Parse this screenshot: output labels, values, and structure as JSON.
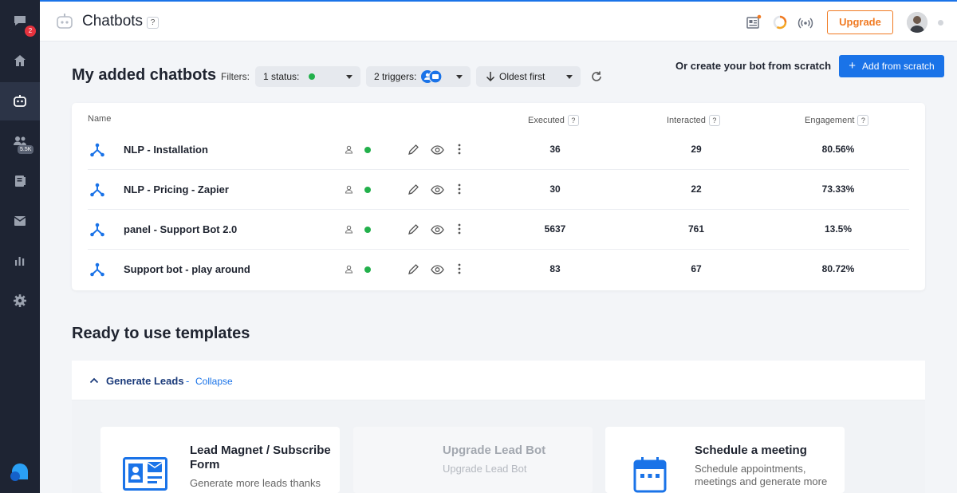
{
  "sidebar": {
    "items": [
      {
        "name": "chat-icon",
        "badge": "2"
      },
      {
        "name": "home-icon"
      },
      {
        "name": "bot-icon"
      },
      {
        "name": "contacts-icon",
        "badge": "5.5K"
      },
      {
        "name": "knowledge-icon"
      },
      {
        "name": "inbox-icon"
      },
      {
        "name": "analytics-icon"
      },
      {
        "name": "settings-icon"
      }
    ]
  },
  "header": {
    "title": "Chatbots",
    "help": "?",
    "upgrade_label": "Upgrade"
  },
  "bots_section": {
    "title": "My added chatbots",
    "filters_label": "Filters:",
    "status_filter": "1 status:",
    "triggers_filter": "2 triggers:",
    "sort_filter": "Oldest first",
    "create_label": "Or create your bot from scratch",
    "add_button": "Add from scratch"
  },
  "table": {
    "columns": {
      "name": "Name",
      "executed": "Executed",
      "interacted": "Interacted",
      "engagement": "Engagement"
    },
    "help": "?",
    "rows": [
      {
        "name": "NLP - Installation",
        "executed": "36",
        "interacted": "29",
        "engagement": "80.56%"
      },
      {
        "name": "NLP - Pricing - Zapier",
        "executed": "30",
        "interacted": "22",
        "engagement": "73.33%"
      },
      {
        "name": "panel - Support Bot 2.0",
        "executed": "5637",
        "interacted": "761",
        "engagement": "13.5%"
      },
      {
        "name": "Support bot - play around",
        "executed": "83",
        "interacted": "67",
        "engagement": "80.72%"
      }
    ]
  },
  "templates": {
    "title": "Ready to use templates",
    "group_title": "Generate Leads",
    "separator": "-",
    "collapse_label": "Collapse",
    "cards": [
      {
        "title": "Lead Magnet / Subscribe Form",
        "desc": "Generate more leads thanks"
      },
      {
        "title": "Upgrade Lead Bot",
        "desc": "Upgrade Lead Bot"
      },
      {
        "title": "Schedule a meeting",
        "desc": "Schedule appointments, meetings and generate more"
      }
    ]
  },
  "colors": {
    "accent": "#1a73e8",
    "upgrade": "#f07a22",
    "status_green": "#22b04b",
    "sidebar": "#1e2433"
  }
}
